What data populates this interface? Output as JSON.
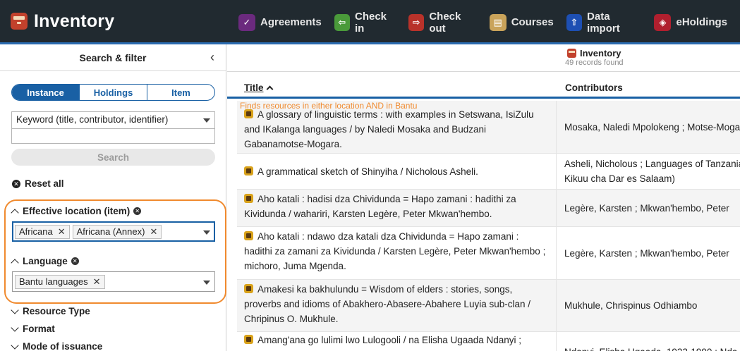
{
  "app": {
    "title": "Inventory",
    "apps": [
      {
        "label": "Agreements",
        "icon": "agreements-icon",
        "color": "#6b2a7e",
        "glyph": "✓"
      },
      {
        "label": "Check in",
        "icon": "check-in-icon",
        "color": "#4a9a3a",
        "glyph": "⇦"
      },
      {
        "label": "Check out",
        "icon": "check-out-icon",
        "color": "#b8322a",
        "glyph": "⇨"
      },
      {
        "label": "Courses",
        "icon": "courses-icon",
        "color": "#c9a35a",
        "glyph": "▤"
      },
      {
        "label": "Data import",
        "icon": "data-import-icon",
        "color": "#1d4fb3",
        "glyph": "⇧"
      },
      {
        "label": "eHoldings",
        "icon": "eholdings-icon",
        "color": "#b01f2e",
        "glyph": "◈"
      }
    ]
  },
  "filters": {
    "title": "Search & filter",
    "segments": [
      "Instance",
      "Holdings",
      "Item"
    ],
    "active_segment": "Instance",
    "keyword_option": "Keyword (title, contributor, identifier)",
    "search_value": "",
    "search_label": "Search",
    "reset_label": "Reset all",
    "accordions": [
      {
        "label": "Effective location (item)",
        "expanded": true,
        "chips": [
          "Africana",
          "Africana (Annex)"
        ]
      },
      {
        "label": "Language",
        "expanded": true,
        "chips": [
          "Bantu languages"
        ]
      },
      {
        "label": "Resource Type",
        "expanded": false
      },
      {
        "label": "Format",
        "expanded": false
      },
      {
        "label": "Mode of issuance",
        "expanded": false
      }
    ],
    "highlight_color": "#f08a2e"
  },
  "results": {
    "title": "Inventory",
    "count": "49 records found",
    "columns": [
      "Title",
      "Contributors"
    ],
    "tooltip": "Finds resources in either location AND in Bantu",
    "rows": [
      {
        "title": "A glossary of linguistic terms : with examples in Setswana, IsiZulu and IKalanga languages / by Naledi Mosaka and Budzani Gabanamotse-Mogara.",
        "contributors": "Mosaka, Naledi Mpolokeng ; Motse-Mogara"
      },
      {
        "title": "A grammatical sketch of Shinyiha / Nicholous Asheli.",
        "contributors": "Asheli, Nicholous ; Languages of Tanzania\nKikuu cha Dar es Salaam)"
      },
      {
        "title": "Aho katali : hadisi dza Chividunda = Hapo zamani : hadithi za Kividunda / wahariri, Karsten Legère, Peter Mkwan'hembo.",
        "contributors": "Legère, Karsten ; Mkwan'hembo, Peter"
      },
      {
        "title": "Aho katali : ndawo dza katali dza Chividunda = Hapo zamani : hadithi za zamani za Kividunda / Karsten Legère, Peter Mkwan'hembo ; michoro, Juma Mgenda.",
        "contributors": "Legère, Karsten ; Mkwan'hembo, Peter"
      },
      {
        "title": "Amakesi ka bakhulundu = Wisdom of elders : stories, songs, proverbs and idioms of Abakhero-Abasere-Abahere Luyia sub-clan / Chripinus O. Mukhule.",
        "contributors": "Mukhule, Chrispinus Odhiambo"
      },
      {
        "title": "Amang'ana go lulimi lwo Lulogooli / na Elisha Ugaada Ndanyi ;",
        "contributors": "Ndanyi, Elisha Ugaada, 1922-1990 ; Nda"
      }
    ]
  }
}
